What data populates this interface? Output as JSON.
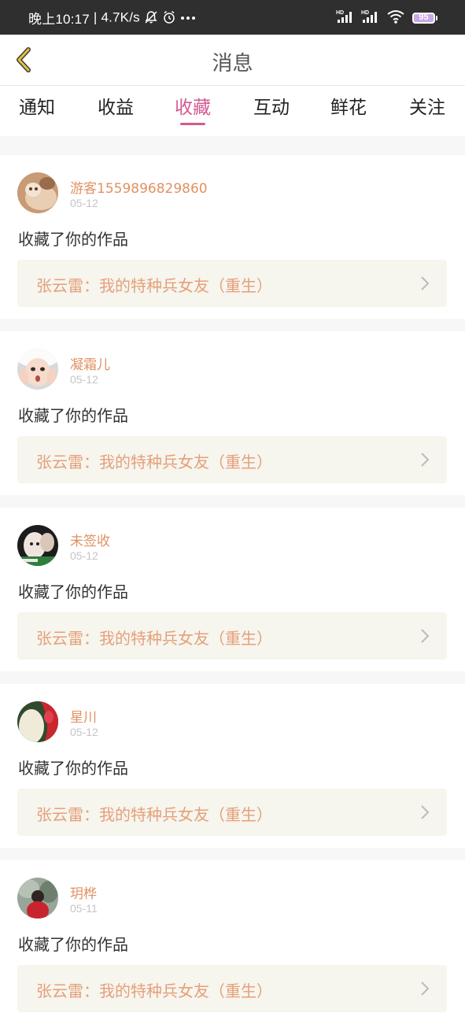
{
  "status_bar": {
    "time": "晚上10:17",
    "separator": "|",
    "net_speed": "4.7K/s",
    "battery": "95",
    "icons": [
      "bell-off-icon",
      "alarm-icon",
      "more-dots-icon",
      "signal-hd-icon",
      "signal-hd-icon",
      "wifi-icon",
      "battery-icon"
    ]
  },
  "header": {
    "title": "消息",
    "back_icon": "chevron-left-icon"
  },
  "tabs": [
    {
      "label": "通知"
    },
    {
      "label": "收益"
    },
    {
      "label": "收藏"
    },
    {
      "label": "互动"
    },
    {
      "label": "鲜花"
    },
    {
      "label": "关注"
    }
  ],
  "active_tab": "收藏",
  "colors": {
    "accent": "#d45a93",
    "username": "#e19163",
    "work_title": "#e5a07a",
    "card_inner_bg": "#f6f5ee",
    "back_icon": "#e0b53a"
  },
  "items": [
    {
      "user": "游客1559896829860",
      "date": "05-12",
      "action": "收藏了你的作品",
      "work": "张云雷：我的特种兵女友（重生）"
    },
    {
      "user": "凝霜儿",
      "date": "05-12",
      "action": "收藏了你的作品",
      "work": "张云雷：我的特种兵女友（重生）"
    },
    {
      "user": "未签收",
      "date": "05-12",
      "action": "收藏了你的作品",
      "work": "张云雷：我的特种兵女友（重生）"
    },
    {
      "user": "星川",
      "date": "05-12",
      "action": "收藏了你的作品",
      "work": "张云雷：我的特种兵女友（重生）"
    },
    {
      "user": "玥桦",
      "date": "05-11",
      "action": "收藏了你的作品",
      "work": "张云雷：我的特种兵女友（重生）"
    }
  ]
}
